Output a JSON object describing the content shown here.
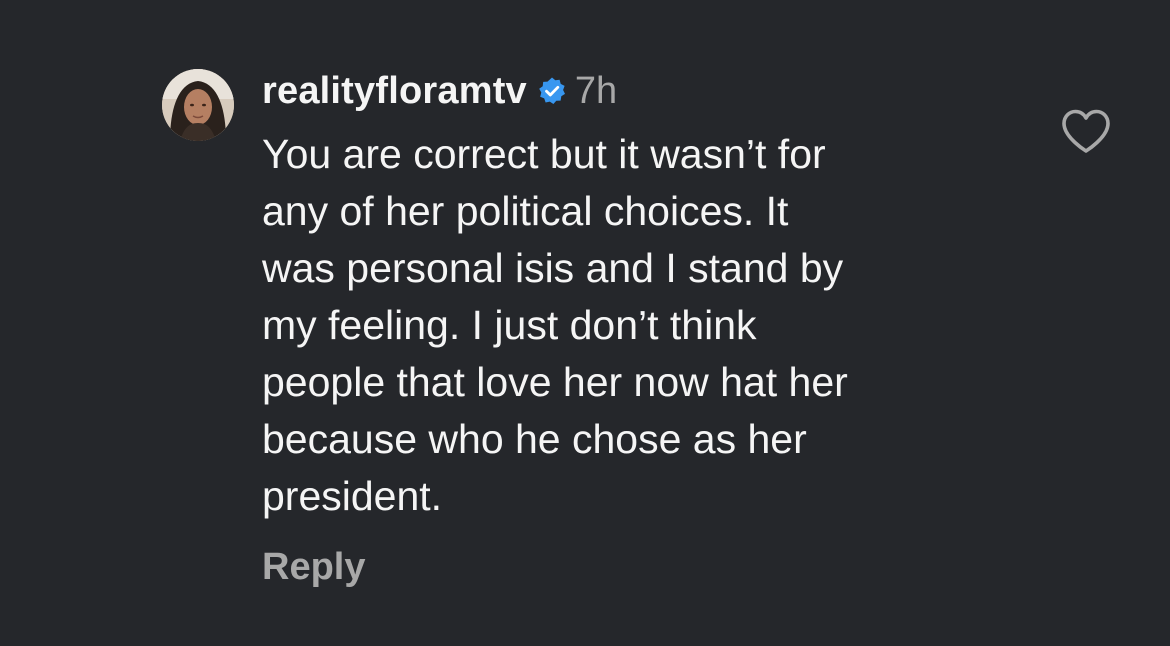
{
  "comment": {
    "username": "realityfloramtv",
    "verified_icon": "verified-badge-icon",
    "timestamp": "7h",
    "text": "You are correct but it wasn’t for\nany of her political choices.  It\nwas personal isis and I stand by\nmy feeling. I just don’t think\npeople that love her now hat her\nbecause who he chose as her\npresident.",
    "reply_label": "Reply",
    "like_icon": "heart-outline-icon",
    "avatar_icon": "avatar-photo"
  },
  "colors": {
    "background": "#25272b",
    "text_primary": "#f5f5f5",
    "text_secondary": "#a8a8a8",
    "verified": "#3897f0"
  }
}
